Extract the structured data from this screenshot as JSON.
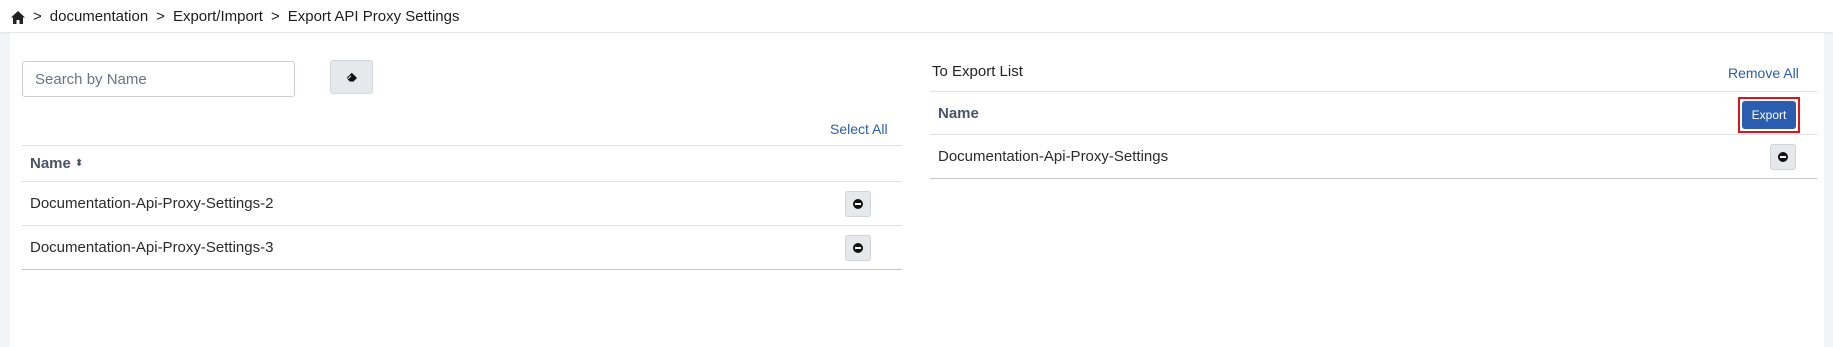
{
  "breadcrumb": {
    "items": [
      "documentation",
      "Export/Import",
      "Export API Proxy Settings"
    ],
    "separator": ">"
  },
  "search": {
    "placeholder": "Search by Name",
    "value": ""
  },
  "left_panel": {
    "select_all_label": "Select All",
    "column_header": "Name",
    "rows": [
      "Documentation-Api-Proxy-Settings-2",
      "Documentation-Api-Proxy-Settings-3"
    ]
  },
  "right_panel": {
    "title": "To Export List",
    "remove_all_label": "Remove All",
    "column_header": "Name",
    "export_label": "Export",
    "rows": [
      "Documentation-Api-Proxy-Settings"
    ]
  },
  "icons": {
    "home": "home-icon",
    "eraser": "eraser-icon",
    "add": "add-circle-icon",
    "remove": "remove-circle-icon",
    "sort": "sort-icon"
  },
  "colors": {
    "link": "#2a5db0",
    "export_button": "#2a5db0",
    "highlight_border": "#e0121b"
  }
}
